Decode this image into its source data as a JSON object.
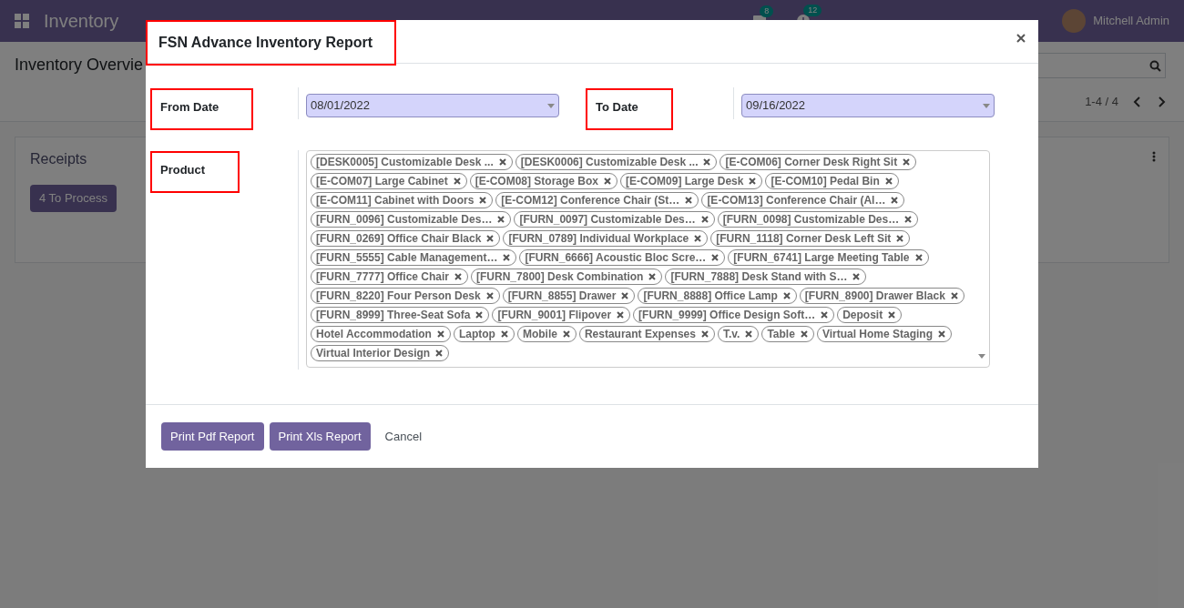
{
  "navbar": {
    "app": "Inventory",
    "messages_count": "8",
    "activity_count": "12",
    "user": "Mitchell Admin"
  },
  "breadcrumb": "Inventory Overvie",
  "pager": "1-4 / 4",
  "cards": [
    {
      "title": "Receipts",
      "button": "4 To Process"
    }
  ],
  "dialog": {
    "title": "FSN Advance Inventory Report",
    "from_date": {
      "label": "From Date",
      "value": "08/01/2022"
    },
    "to_date": {
      "label": "To Date",
      "value": "09/16/2022"
    },
    "product": {
      "label": "Product",
      "tags": [
        "[DESK0005] Customizable Desk ...",
        "[DESK0006] Customizable Desk ...",
        "[E-COM06] Corner Desk Right Sit",
        "[E-COM07] Large Cabinet",
        "[E-COM08] Storage Box",
        "[E-COM09] Large Desk",
        "[E-COM10] Pedal Bin",
        "[E-COM11] Cabinet with Doors",
        "[E-COM12] Conference Chair (St…",
        "[E-COM13] Conference Chair (Al…",
        "[FURN_0096] Customizable Des…",
        "[FURN_0097] Customizable Des…",
        "[FURN_0098] Customizable Des…",
        "[FURN_0269] Office Chair Black",
        "[FURN_0789] Individual Workplace",
        "[FURN_1118] Corner Desk Left Sit",
        "[FURN_5555] Cable Management…",
        "[FURN_6666] Acoustic Bloc Scre…",
        "[FURN_6741] Large Meeting Table",
        "[FURN_7777] Office Chair",
        "[FURN_7800] Desk Combination",
        "[FURN_7888] Desk Stand with S…",
        "[FURN_8220] Four Person Desk",
        "[FURN_8855] Drawer",
        "[FURN_8888] Office Lamp",
        "[FURN_8900] Drawer Black",
        "[FURN_8999] Three-Seat Sofa",
        "[FURN_9001] Flipover",
        "[FURN_9999] Office Design Soft…",
        "Deposit",
        "Hotel Accommodation",
        "Laptop",
        "Mobile",
        "Restaurant Expenses",
        "T.v.",
        "Table",
        "Virtual Home Staging",
        "Virtual Interior Design"
      ]
    },
    "buttons": [
      {
        "label": "Print Pdf Report",
        "kind": "primary"
      },
      {
        "label": "Print Xls Report",
        "kind": "primary"
      },
      {
        "label": "Cancel",
        "kind": "link"
      }
    ]
  }
}
